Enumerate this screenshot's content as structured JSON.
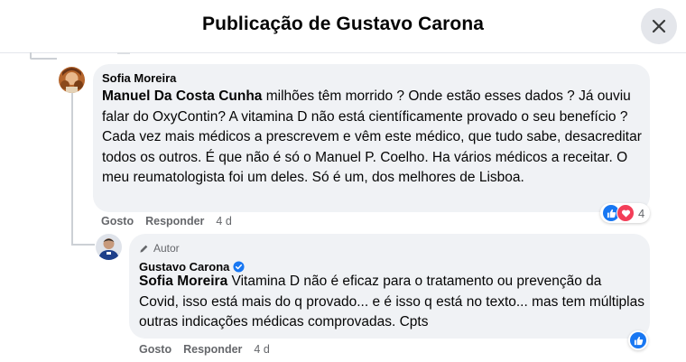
{
  "header": {
    "title": "Publicação de Gustavo Carona"
  },
  "comment1": {
    "author": "Sofia Moreira",
    "mention": "Manuel Da Costa Cunha",
    "text": " milhões têm morrido ? Onde estão esses dados ? Já ouviu falar do OxyContin? A vitamina D não está científicamente provado o seu benefício ? Cada vez mais médicos a prescrevem e vêm este médico, que tudo sabe, desacreditar todos os outros. É que não é só o Manuel P. Coelho. Ha vários médicos a receitar. O meu reumatologista foi um deles. Só é um, dos melhores de Lisboa.",
    "actions": {
      "like": "Gosto",
      "reply": "Responder",
      "time": "4 d"
    },
    "reaction_count": "4",
    "reactions": [
      "like-icon",
      "love-icon"
    ]
  },
  "comment2": {
    "badge": "Autor",
    "author": "Gustavo Carona",
    "mention": "Sofia Moreira",
    "text": " Vitamina D não é eficaz para o tratamento ou prevenção da Covid, isso está mais do q provado... e é isso q está no texto... mas tem múltiplas outras indicações médicas comprovadas. Cpts",
    "actions": {
      "like": "Gosto",
      "reply": "Responder",
      "time": "4 d"
    },
    "reactions": [
      "like-icon"
    ]
  },
  "colors": {
    "accent": "#1877f2",
    "love": "#f33e58",
    "bubble": "#f0f2f5",
    "secondary_text": "#65676b"
  }
}
